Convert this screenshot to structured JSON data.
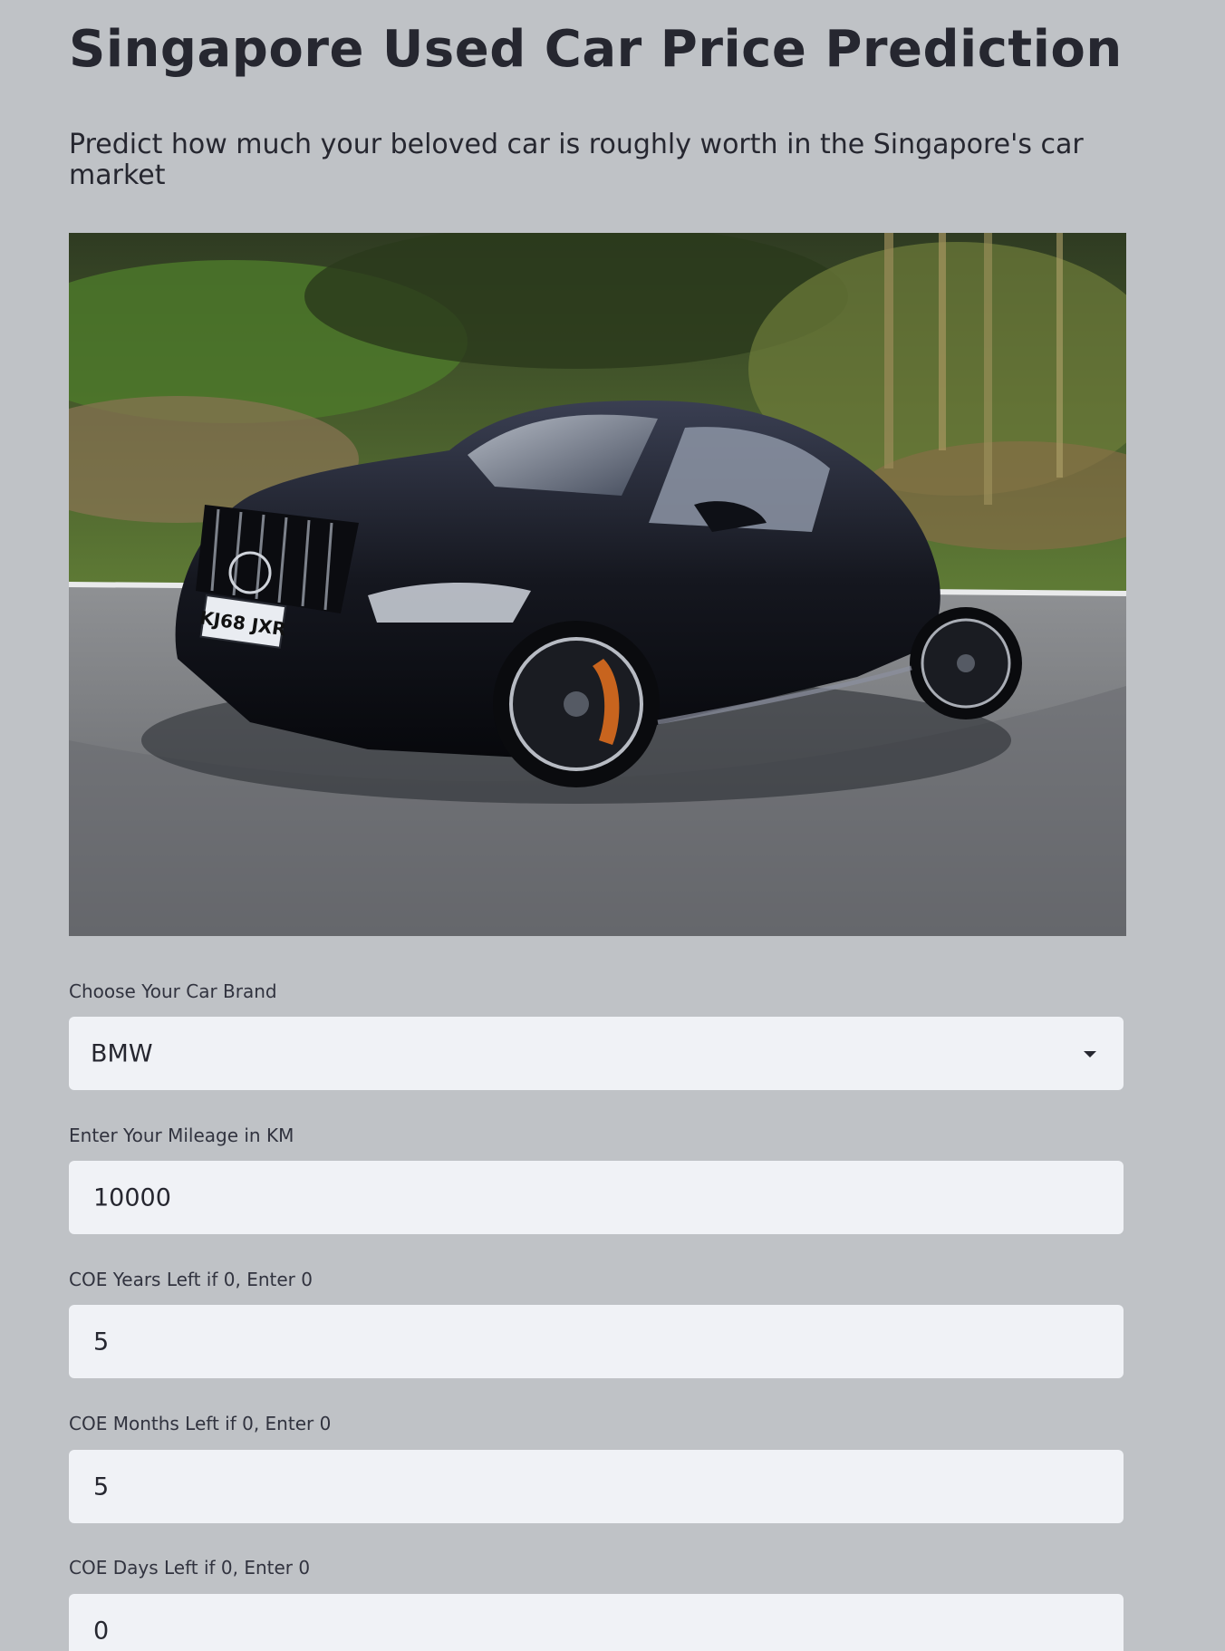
{
  "header": {
    "title": "Singapore Used Car Price Prediction",
    "subtitle": "Predict how much your beloved car is roughly worth in the Singapore's car market"
  },
  "hero_image": {
    "alt": "Black coupe driving on a road",
    "plate_text": "KJ68 JXR"
  },
  "form": {
    "brand": {
      "label": "Choose Your Car Brand",
      "value": "BMW"
    },
    "mileage": {
      "label": "Enter Your Mileage in KM",
      "value": "10000"
    },
    "coe_years": {
      "label": "COE Years Left if 0, Enter 0",
      "value": "5"
    },
    "coe_months": {
      "label": "COE Months Left if 0, Enter 0",
      "value": "5"
    },
    "coe_days": {
      "label": "COE Days Left if 0, Enter 0",
      "value": "0"
    }
  },
  "icons": {
    "select_caret": "chevron-down-icon"
  },
  "colors": {
    "background": "#bfc2c6",
    "input_background": "#f0f2f6",
    "text": "#262730"
  }
}
